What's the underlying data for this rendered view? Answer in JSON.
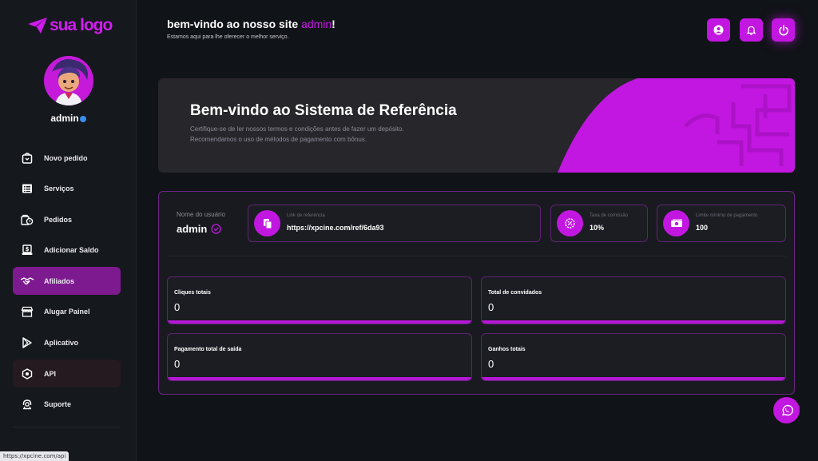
{
  "brand": {
    "logo_text": "sua logo",
    "accent": "#c217e0"
  },
  "sidebar": {
    "username": "admin",
    "items": [
      {
        "label": "Novo pedido",
        "icon": "bag-icon"
      },
      {
        "label": "Serviços",
        "icon": "list-icon"
      },
      {
        "label": "Pedidos",
        "icon": "orders-icon"
      },
      {
        "label": "Adicionar Saldo",
        "icon": "wallet-icon"
      },
      {
        "label": "Afiliados",
        "icon": "handshake-icon",
        "active": true
      },
      {
        "label": "Alugar Painel",
        "icon": "store-icon"
      },
      {
        "label": "Aplicativo",
        "icon": "play-store-icon"
      },
      {
        "label": "API",
        "icon": "api-icon"
      },
      {
        "label": "Suporte",
        "icon": "support-icon"
      }
    ]
  },
  "header": {
    "welcome_prefix": "bem-vindo ao nosso site ",
    "welcome_user": "admin",
    "welcome_suffix": "!",
    "subtitle": "Estamos aqui para lhe oferecer o melhor serviço."
  },
  "banner": {
    "title": "Bem-vindo ao Sistema de Referência",
    "line1": "Certifique-se de ler nossos termos e condições antes de fazer um depósito.",
    "line2": "Recomendamos o uso de métodos de pagamento com bônus."
  },
  "affiliate": {
    "username_label": "Nome do usuário",
    "username_value": "admin",
    "ref_link_label": "Link de referência",
    "ref_link_value": "https://xpcine.com/ref/6da93",
    "commission_label": "Taxa de comissão",
    "commission_value": "10%",
    "min_payout_label": "Limite mínimo de pagamento",
    "min_payout_value": "100"
  },
  "stats": {
    "clicks_label": "Cliques totais",
    "clicks_value": "0",
    "invited_label": "Total de convidados",
    "invited_value": "0",
    "payout_label": "Pagamento total de saída",
    "payout_value": "0",
    "earnings_label": "Ganhos totais",
    "earnings_value": "0"
  },
  "status_bar": {
    "url": "https://xpcine.com/api"
  }
}
